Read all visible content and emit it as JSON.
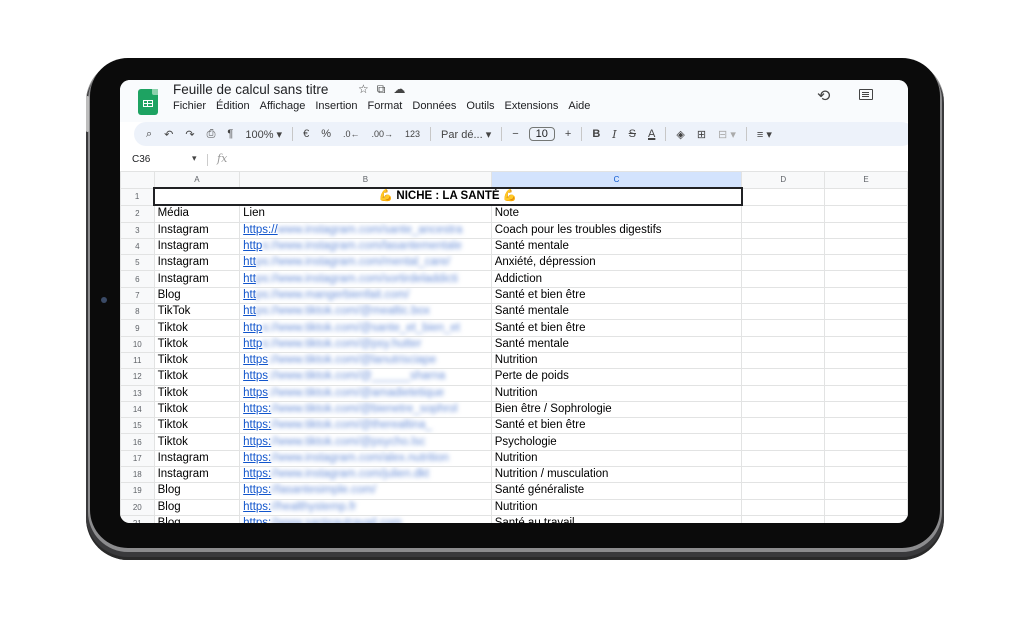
{
  "app": {
    "title": "Feuille de calcul sans titre",
    "title_icons": [
      "star-icon",
      "move-to-folder-icon",
      "cloud-status-icon"
    ],
    "menu": [
      "Fichier",
      "Édition",
      "Affichage",
      "Insertion",
      "Format",
      "Données",
      "Outils",
      "Extensions",
      "Aide"
    ],
    "right_icons": [
      "history-icon",
      "comment-icon"
    ]
  },
  "toolbar": {
    "search": "🔍",
    "undo": "↶",
    "redo": "↷",
    "print": "⎙",
    "paint_format": "🖌",
    "zoom": "100%",
    "currency": "€",
    "percent": "%",
    "decrease_decimal": ".0←",
    "increase_decimal": ".00→",
    "number_format": "123",
    "font": "Par dé...",
    "font_size_minus": "−",
    "font_size": "10",
    "font_size_plus": "+",
    "bold": "B",
    "italic": "I",
    "strikethrough": "S",
    "text_color": "A",
    "fill_color": "◈",
    "borders": "⊞",
    "merge": "⊟",
    "align": "≡",
    "caret": "▾"
  },
  "formula_bar": {
    "cell_ref": "C36",
    "caret": "▾",
    "fx": "fx",
    "value": ""
  },
  "columns": [
    "A",
    "B",
    "C",
    "D",
    "E"
  ],
  "selected_column": "C",
  "title_row": {
    "row": "1",
    "text": "💪 NICHE : LA SANTÉ 💪"
  },
  "header_row": {
    "row": "2",
    "media": "Média",
    "link": "Lien",
    "note": "Note"
  },
  "rows": [
    {
      "row": "3",
      "media": "Instagram",
      "link_prefix": "https://",
      "link_blurred": "www.instagram.com/sante_ancestra",
      "note": "Coach pour les troubles digestifs"
    },
    {
      "row": "4",
      "media": "Instagram",
      "link_prefix": "http",
      "link_blurred": "s://www.instagram.com/lasantementale",
      "note": "Santé mentale"
    },
    {
      "row": "5",
      "media": "Instagram",
      "link_prefix": "htt",
      "link_blurred": "ps://www.instagram.com/mental_care/",
      "note": "Anxiété, dépression"
    },
    {
      "row": "6",
      "media": "Instagram",
      "link_prefix": "htt",
      "link_blurred": "ps://www.instagram.com/sortirdeladdicti",
      "note": "Addiction"
    },
    {
      "row": "7",
      "media": "Blog",
      "link_prefix": "htt",
      "link_blurred": "ps://www.mangerbienfait.com/",
      "note": "Santé et bien être"
    },
    {
      "row": "8",
      "media": "TikTok",
      "link_prefix": "htt",
      "link_blurred": "ps://www.tiktok.com/@mealtic.box",
      "note": "Santé mentale"
    },
    {
      "row": "9",
      "media": "Tiktok",
      "link_prefix": "http",
      "link_blurred": "s://www.tiktok.com/@sante_et_bien_et",
      "note": "Santé et bien être"
    },
    {
      "row": "10",
      "media": "Tiktok",
      "link_prefix": "http",
      "link_blurred": "s://www.tiktok.com/@psy.hutter",
      "note": "Santé mentale"
    },
    {
      "row": "11",
      "media": "Tiktok",
      "link_prefix": "https",
      "link_blurred": "://www.tiktok.com/@lanutrisciape",
      "note": "Nutrition"
    },
    {
      "row": "12",
      "media": "Tiktok",
      "link_prefix": "https",
      "link_blurred": "://www.tiktok.com/@______sharna",
      "note": "Perte de poids"
    },
    {
      "row": "13",
      "media": "Tiktok",
      "link_prefix": "https",
      "link_blurred": "://www.tiktok.com/@amadietetique",
      "note": "Nutrition"
    },
    {
      "row": "14",
      "media": "Tiktok",
      "link_prefix": "https:",
      "link_blurred": "//www.tiktok.com/@bienetre_sophrol",
      "note": "Bien être / Sophrologie"
    },
    {
      "row": "15",
      "media": "Tiktok",
      "link_prefix": "https:",
      "link_blurred": "//www.tiktok.com/@therealtina_",
      "note": "Santé et bien être"
    },
    {
      "row": "16",
      "media": "Tiktok",
      "link_prefix": "https:",
      "link_blurred": "//www.tiktok.com/@psycho.lsc",
      "note": "Psychologie"
    },
    {
      "row": "17",
      "media": "Instagram",
      "link_prefix": "https:",
      "link_blurred": "//www.instagram.com/alex.nutrition",
      "note": "Nutrition"
    },
    {
      "row": "18",
      "media": "Instagram",
      "link_prefix": "https:",
      "link_blurred": "//www.instagram.com/julien.dkt",
      "note": "Nutrition / musculation"
    },
    {
      "row": "19",
      "media": "Blog",
      "link_prefix": "https:",
      "link_blurred": "//lasantesimple.com/",
      "note": "Santé généraliste"
    },
    {
      "row": "20",
      "media": "Blog",
      "link_prefix": "https:",
      "link_blurred": "//healthystemp.fr",
      "note": "Nutrition"
    },
    {
      "row": "21",
      "media": "Blog",
      "link_prefix": "https:",
      "link_blurred": "//www.santeautravail.com",
      "note": "Santé au travail"
    }
  ]
}
